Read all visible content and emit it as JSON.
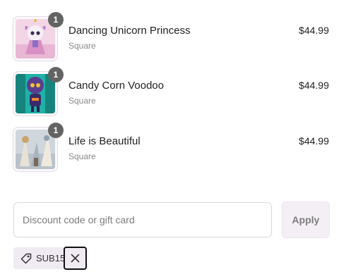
{
  "cart": {
    "items": [
      {
        "title": "Dancing Unicorn Princess",
        "variant": "Square",
        "price": "$44.99",
        "quantity": "1",
        "image_icon": "unicorn-art-thumbnail"
      },
      {
        "title": "Candy Corn Voodoo",
        "variant": "Square",
        "price": "$44.99",
        "quantity": "1",
        "image_icon": "voodoo-doll-art-thumbnail"
      },
      {
        "title": "Life is Beautiful",
        "variant": "Square",
        "price": "$44.99",
        "quantity": "1",
        "image_icon": "landscape-art-thumbnail"
      }
    ]
  },
  "discount": {
    "placeholder": "Discount code or gift card",
    "value": "",
    "apply_label": "Apply",
    "applied_code": "SUB15",
    "tag_icon": "tag-icon",
    "remove_icon": "close-icon"
  },
  "colors": {
    "badge": "#636363",
    "apply_bg": "#f4eff5",
    "chip_bg": "#f0ebf2"
  }
}
